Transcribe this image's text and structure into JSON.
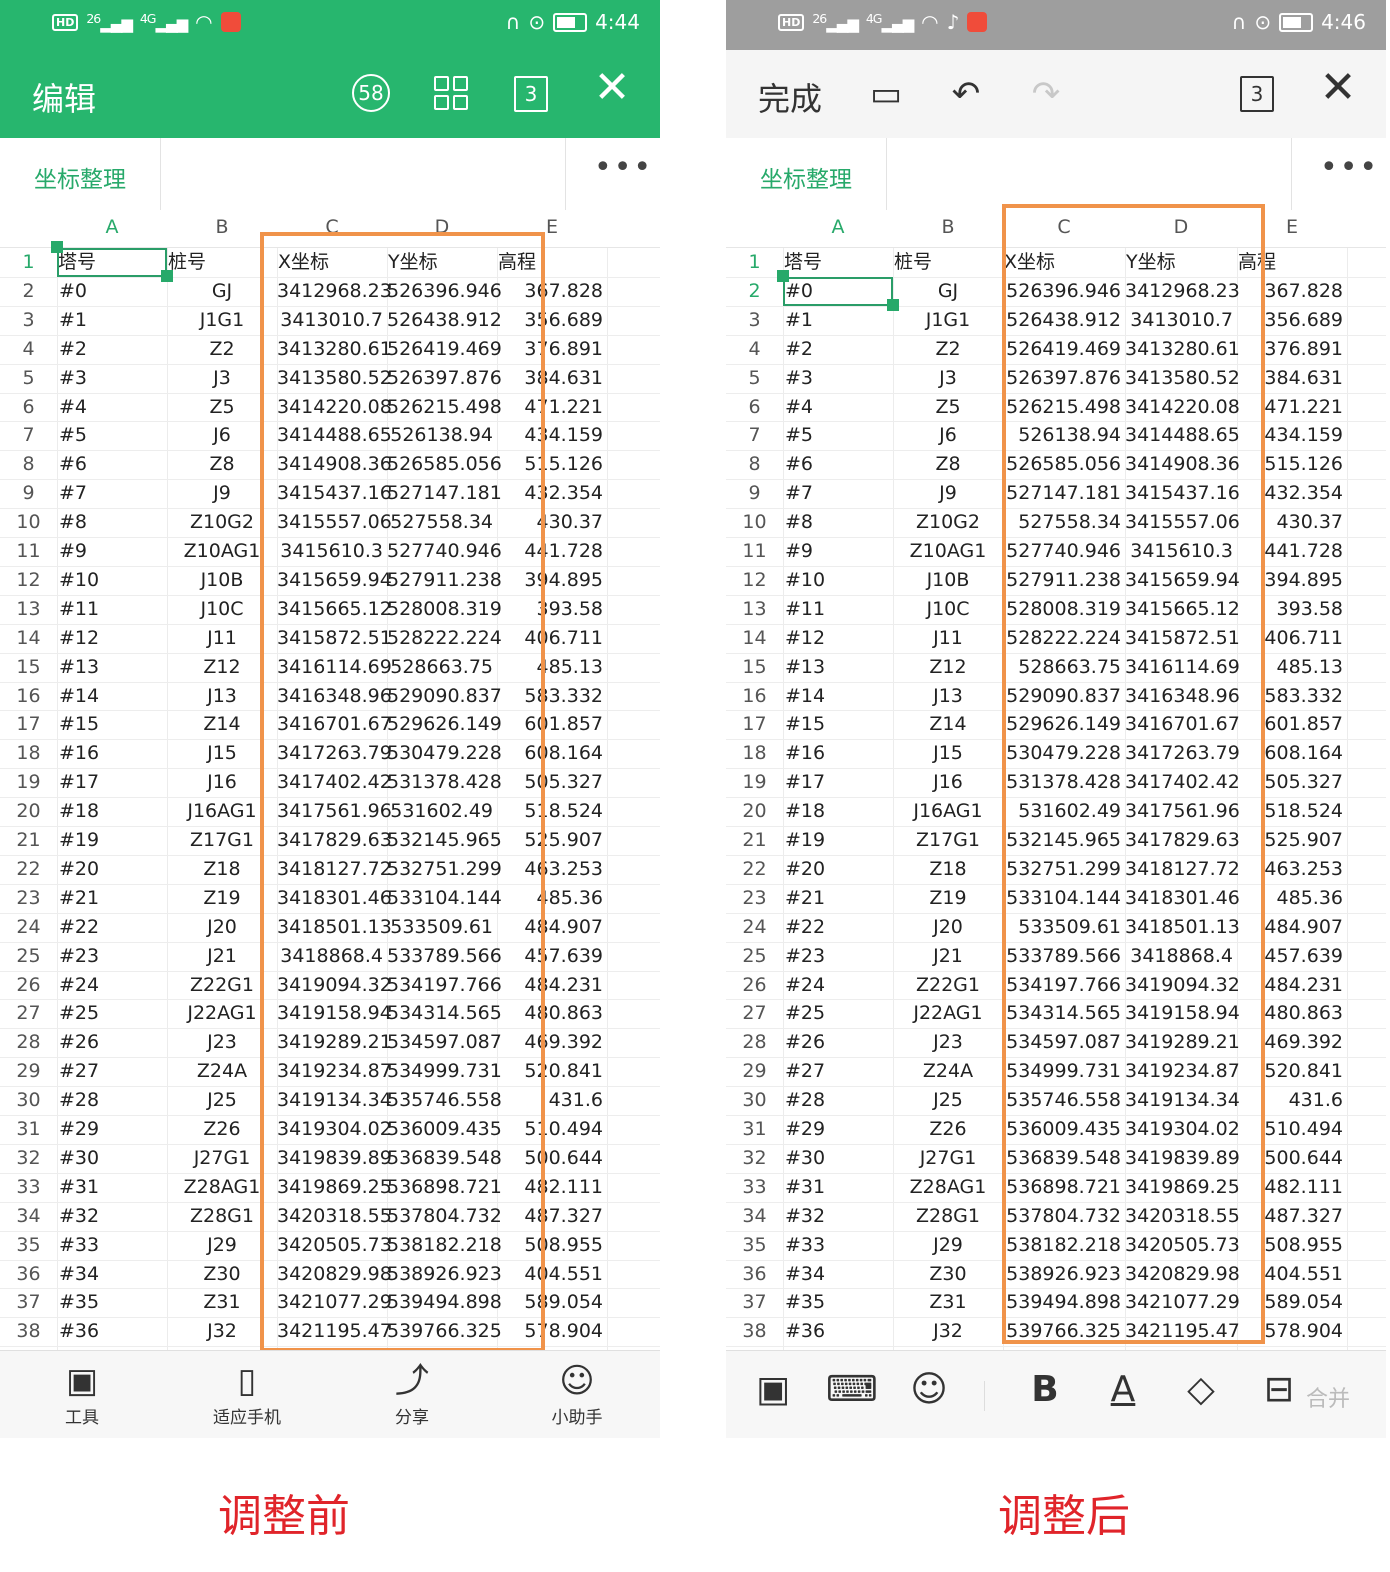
{
  "left": {
    "status": {
      "net": "26",
      "lte": "4G",
      "time": "4:44"
    },
    "toolbar": {
      "title": "编辑",
      "circle_num": "58",
      "box_num": "3"
    },
    "sheet_tab": "坐标整理",
    "col_letters": [
      "A",
      "B",
      "C",
      "D",
      "E"
    ],
    "header_row": {
      "n": "1",
      "a": "塔号",
      "b": "桩号",
      "c": "X坐标",
      "d": "Y坐标",
      "e": "高程"
    },
    "rows": [
      [
        "2",
        "#0",
        "GJ",
        "3412968.23",
        "526396.946",
        "367.828"
      ],
      [
        "3",
        "#1",
        "J1G1",
        "3413010.7",
        "526438.912",
        "356.689"
      ],
      [
        "4",
        "#2",
        "Z2",
        "3413280.61",
        "526419.469",
        "376.891"
      ],
      [
        "5",
        "#3",
        "J3",
        "3413580.52",
        "526397.876",
        "384.631"
      ],
      [
        "6",
        "#4",
        "Z5",
        "3414220.08",
        "526215.498",
        "471.221"
      ],
      [
        "7",
        "#5",
        "J6",
        "3414488.65",
        "526138.94",
        "434.159"
      ],
      [
        "8",
        "#6",
        "Z8",
        "3414908.36",
        "526585.056",
        "515.126"
      ],
      [
        "9",
        "#7",
        "J9",
        "3415437.16",
        "527147.181",
        "432.354"
      ],
      [
        "10",
        "#8",
        "Z10G2",
        "3415557.06",
        "527558.34",
        "430.37"
      ],
      [
        "11",
        "#9",
        "Z10AG1",
        "3415610.3",
        "527740.946",
        "441.728"
      ],
      [
        "12",
        "#10",
        "J10B",
        "3415659.94",
        "527911.238",
        "394.895"
      ],
      [
        "13",
        "#11",
        "J10C",
        "3415665.12",
        "528008.319",
        "393.58"
      ],
      [
        "14",
        "#12",
        "J11",
        "3415872.51",
        "528222.224",
        "406.711"
      ],
      [
        "15",
        "#13",
        "Z12",
        "3416114.69",
        "528663.75",
        "485.13"
      ],
      [
        "16",
        "#14",
        "J13",
        "3416348.96",
        "529090.837",
        "583.332"
      ],
      [
        "17",
        "#15",
        "Z14",
        "3416701.67",
        "529626.149",
        "601.857"
      ],
      [
        "18",
        "#16",
        "J15",
        "3417263.79",
        "530479.228",
        "608.164"
      ],
      [
        "19",
        "#17",
        "J16",
        "3417402.42",
        "531378.428",
        "505.327"
      ],
      [
        "20",
        "#18",
        "J16AG1",
        "3417561.96",
        "531602.49",
        "518.524"
      ],
      [
        "21",
        "#19",
        "Z17G1",
        "3417829.63",
        "532145.965",
        "525.907"
      ],
      [
        "22",
        "#20",
        "Z18",
        "3418127.72",
        "532751.299",
        "463.253"
      ],
      [
        "23",
        "#21",
        "Z19",
        "3418301.46",
        "533104.144",
        "485.36"
      ],
      [
        "24",
        "#22",
        "J20",
        "3418501.13",
        "533509.61",
        "484.907"
      ],
      [
        "25",
        "#23",
        "J21",
        "3418868.4",
        "533789.566",
        "457.639"
      ],
      [
        "26",
        "#24",
        "Z22G1",
        "3419094.32",
        "534197.766",
        "484.231"
      ],
      [
        "27",
        "#25",
        "J22AG1",
        "3419158.94",
        "534314.565",
        "480.863"
      ],
      [
        "28",
        "#26",
        "J23",
        "3419289.21",
        "534597.087",
        "469.392"
      ],
      [
        "29",
        "#27",
        "Z24A",
        "3419234.87",
        "534999.731",
        "520.841"
      ],
      [
        "30",
        "#28",
        "J25",
        "3419134.34",
        "535746.558",
        "431.6"
      ],
      [
        "31",
        "#29",
        "Z26",
        "3419304.02",
        "536009.435",
        "510.494"
      ],
      [
        "32",
        "#30",
        "J27G1",
        "3419839.89",
        "536839.548",
        "500.644"
      ],
      [
        "33",
        "#31",
        "Z28AG1",
        "3419869.25",
        "536898.721",
        "482.111"
      ],
      [
        "34",
        "#32",
        "Z28G1",
        "3420318.55",
        "537804.732",
        "487.327"
      ],
      [
        "35",
        "#33",
        "J29",
        "3420505.73",
        "538182.218",
        "508.955"
      ],
      [
        "36",
        "#34",
        "Z30",
        "3420829.98",
        "538926.923",
        "404.551"
      ],
      [
        "37",
        "#35",
        "Z31",
        "3421077.29",
        "539494.898",
        "589.054"
      ],
      [
        "38",
        "#36",
        "J32",
        "3421195.47",
        "539766.325",
        "578.904"
      ]
    ],
    "bottom": [
      {
        "icon": "tools-grid-icon",
        "label": "工具"
      },
      {
        "icon": "fit-phone-icon",
        "label": "适应手机"
      },
      {
        "icon": "share-icon",
        "label": "分享"
      },
      {
        "icon": "assistant-icon",
        "label": "小助手"
      }
    ],
    "caption": "调整前"
  },
  "right": {
    "status": {
      "net": "26",
      "lte": "4G",
      "time": "4:46"
    },
    "toolbar": {
      "done_label": "完成",
      "box_num": "3"
    },
    "sheet_tab": "坐标整理",
    "col_letters": [
      "A",
      "B",
      "C",
      "D",
      "E"
    ],
    "header_row": {
      "n": "1",
      "a": "塔号",
      "b": "桩号",
      "c": "X坐标",
      "d": "Y坐标",
      "e": "高程"
    },
    "bottom_merge_label": "合并",
    "caption": "调整后"
  },
  "colors": {
    "green": "#27b66e",
    "orange_box": "#f0934a",
    "caption_red": "#e0242a"
  }
}
